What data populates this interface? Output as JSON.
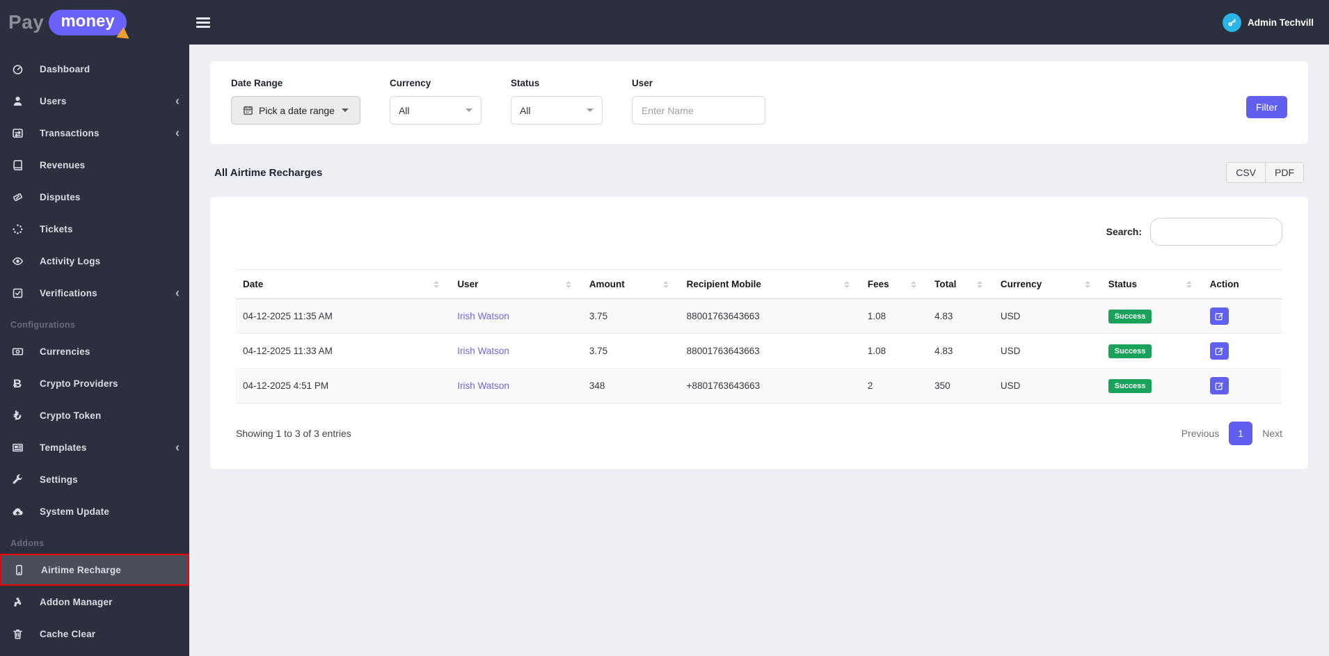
{
  "brand": {
    "pay": "Pay",
    "money": "money"
  },
  "topbar": {
    "admin_name": "Admin Techvill"
  },
  "sidebar": {
    "sections": {
      "configurations": "Configurations",
      "addons": "Addons"
    },
    "items": [
      {
        "label": "Dashboard",
        "icon": "dashboard-icon"
      },
      {
        "label": "Users",
        "icon": "users-icon"
      },
      {
        "label": "Transactions",
        "icon": "transactions-icon"
      },
      {
        "label": "Revenues",
        "icon": "revenues-icon"
      },
      {
        "label": "Disputes",
        "icon": "disputes-icon"
      },
      {
        "label": "Tickets",
        "icon": "tickets-icon"
      },
      {
        "label": "Activity Logs",
        "icon": "activity-logs-icon"
      },
      {
        "label": "Verifications",
        "icon": "verifications-icon"
      },
      {
        "label": "Currencies",
        "icon": "currencies-icon"
      },
      {
        "label": "Crypto Providers",
        "icon": "crypto-providers-icon"
      },
      {
        "label": "Crypto Token",
        "icon": "crypto-token-icon"
      },
      {
        "label": "Templates",
        "icon": "templates-icon"
      },
      {
        "label": "Settings",
        "icon": "settings-icon"
      },
      {
        "label": "System Update",
        "icon": "system-update-icon"
      },
      {
        "label": "Airtime Recharge",
        "icon": "airtime-recharge-icon"
      },
      {
        "label": "Addon Manager",
        "icon": "addon-manager-icon"
      },
      {
        "label": "Cache Clear",
        "icon": "cache-clear-icon"
      }
    ]
  },
  "filters": {
    "date_range": {
      "label": "Date Range",
      "value": "Pick a date range"
    },
    "currency": {
      "label": "Currency",
      "value": "All"
    },
    "status": {
      "label": "Status",
      "value": "All"
    },
    "user": {
      "label": "User",
      "placeholder": "Enter Name"
    },
    "filter_button": "Filter"
  },
  "page": {
    "title": "All Airtime Recharges",
    "export_csv": "CSV",
    "export_pdf": "PDF"
  },
  "table": {
    "search_label": "Search:",
    "columns": [
      "Date",
      "User",
      "Amount",
      "Recipient Mobile",
      "Fees",
      "Total",
      "Currency",
      "Status",
      "Action"
    ],
    "rows": [
      {
        "date": "04-12-2025 11:35 AM",
        "user": "Irish Watson",
        "amount": "3.75",
        "recipient": "88001763643663",
        "fees": "1.08",
        "total": "4.83",
        "currency": "USD",
        "status": "Success"
      },
      {
        "date": "04-12-2025 11:33 AM",
        "user": "Irish Watson",
        "amount": "3.75",
        "recipient": "88001763643663",
        "fees": "1.08",
        "total": "4.83",
        "currency": "USD",
        "status": "Success"
      },
      {
        "date": "04-12-2025 4:51 PM",
        "user": "Irish Watson",
        "amount": "348",
        "recipient": "+8801763643663",
        "fees": "2",
        "total": "350",
        "currency": "USD",
        "status": "Success"
      }
    ],
    "summary": "Showing 1 to 3 of 3 entries",
    "pagination": {
      "previous": "Previous",
      "page": "1",
      "next": "Next"
    }
  },
  "colors": {
    "accent": "#6160ee",
    "success": "#19a25a",
    "sidebar": "#2c2f3d",
    "active_highlight_border": "#ee0202",
    "link": "#7066e0",
    "avatar": "#29b5e8",
    "logo_pill": "#6a62fa"
  }
}
